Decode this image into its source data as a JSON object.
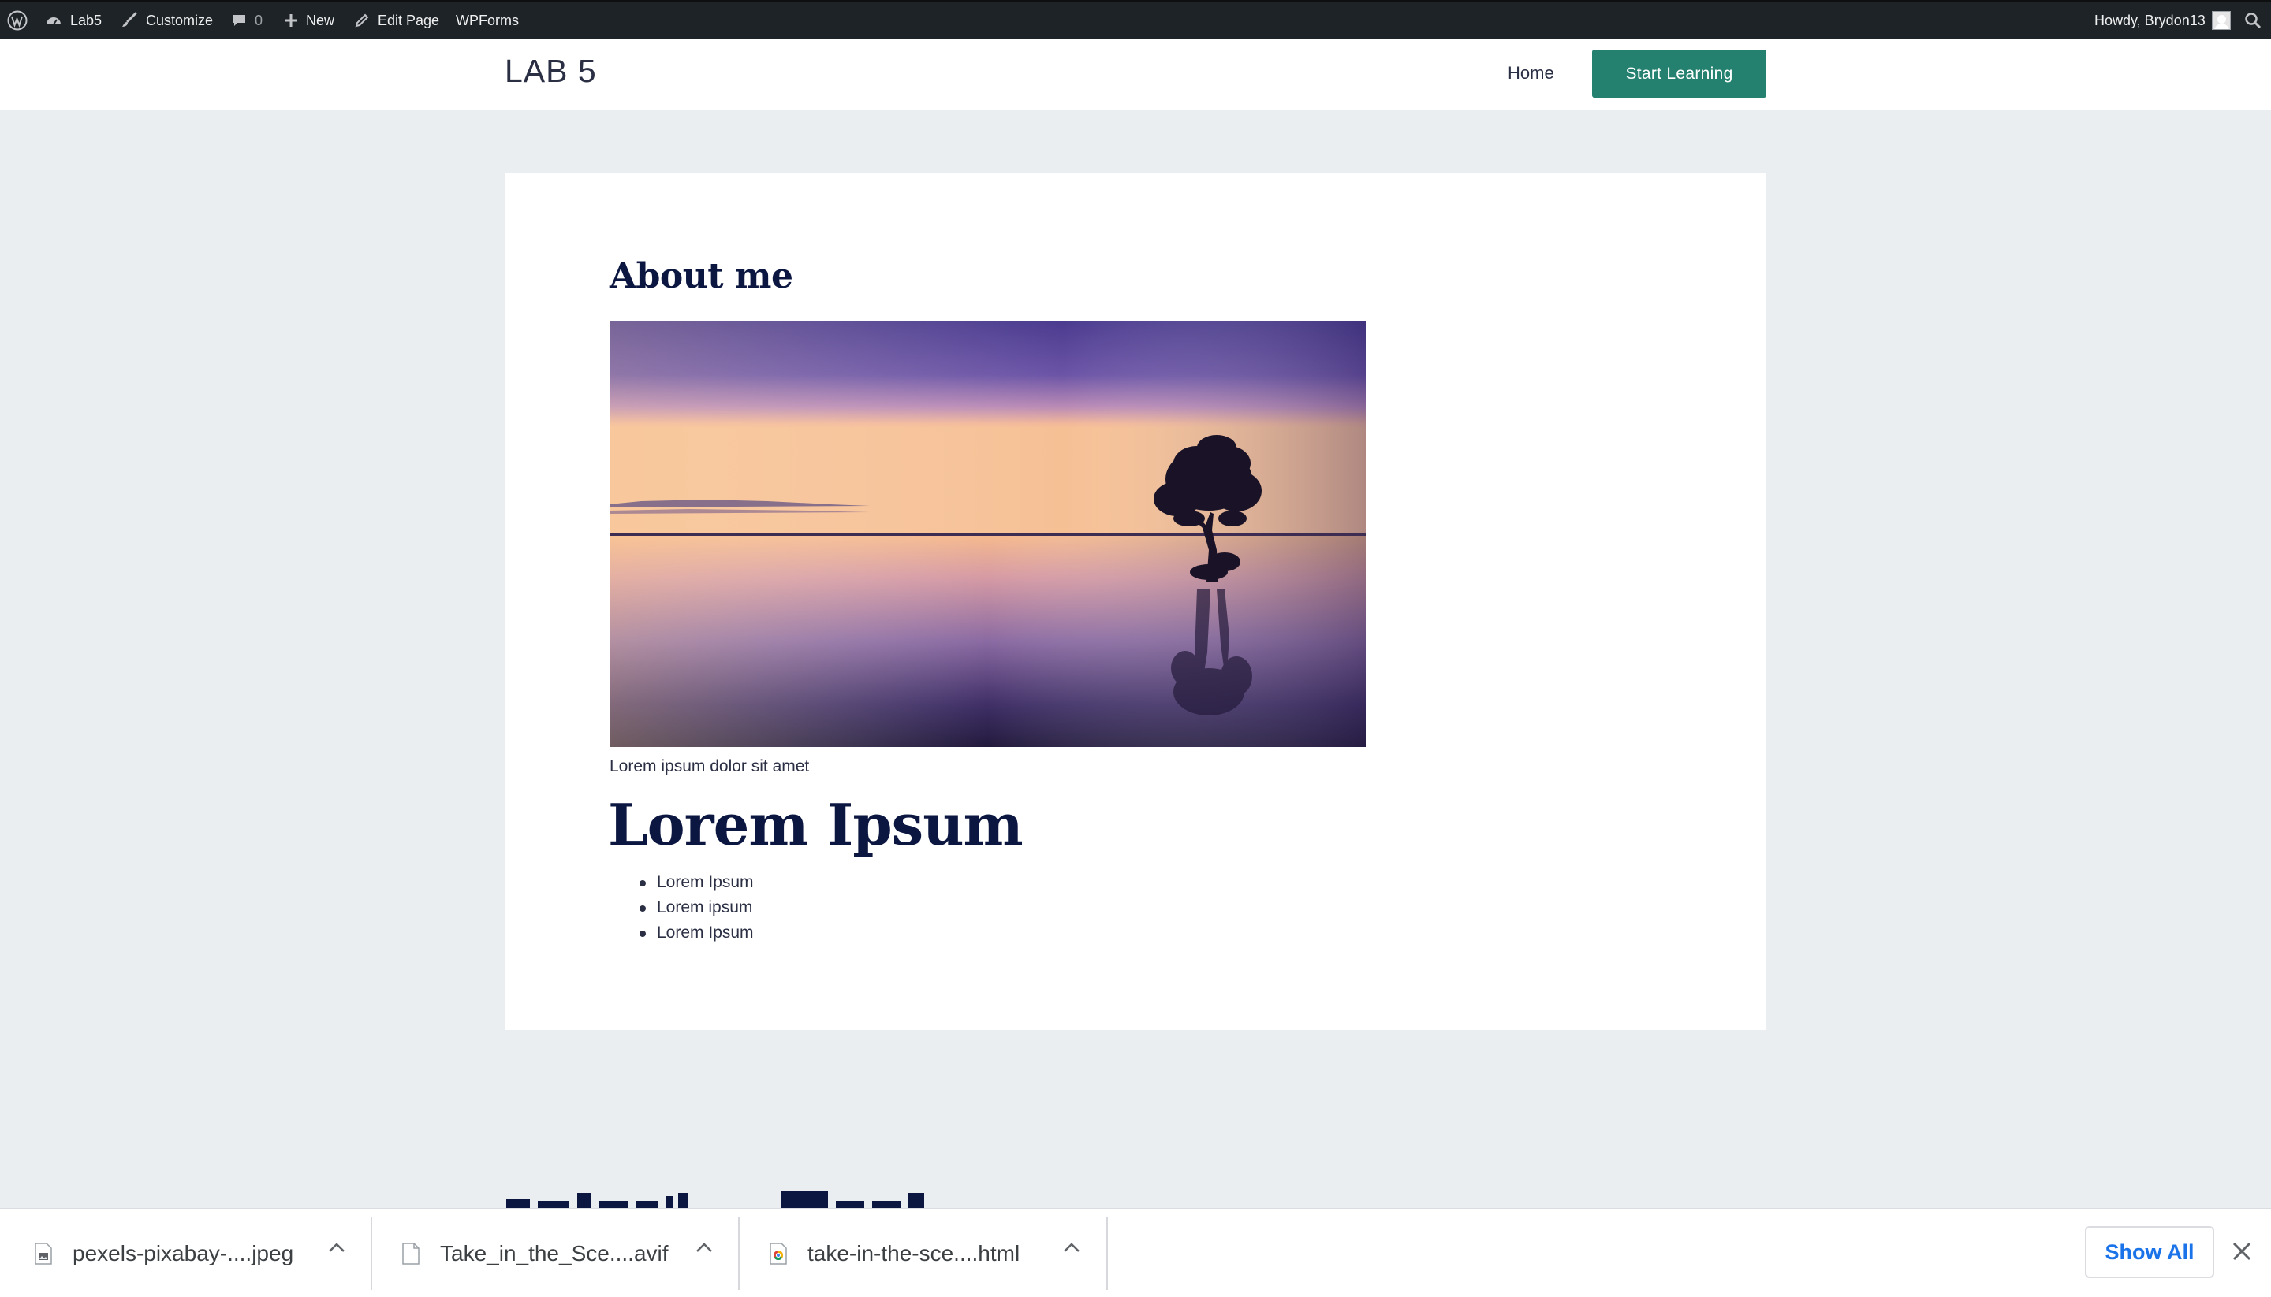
{
  "admin_bar": {
    "site_name": "Lab5",
    "customize": "Customize",
    "comments_count": "0",
    "new_label": "New",
    "edit_page": "Edit Page",
    "wpforms": "WPForms",
    "howdy": "Howdy, Brydon13"
  },
  "header": {
    "site_title": "LAB 5",
    "nav_home": "Home",
    "cta_label": "Start Learning"
  },
  "content": {
    "about_title": "About me",
    "image_caption": "Lorem ipsum dolor sit amet",
    "heading": "Lorem Ipsum",
    "list": [
      "Lorem Ipsum",
      "Lorem ipsum",
      "Lorem Ipsum"
    ]
  },
  "downloads": {
    "items": [
      {
        "name": "pexels-pixabay-....jpeg"
      },
      {
        "name": "Take_in_the_Sce....avif"
      },
      {
        "name": "take-in-the-sce....html"
      }
    ],
    "show_all": "Show All"
  },
  "colors": {
    "admin_bar_bg": "#1d2327",
    "page_bg": "#ebeef1",
    "heading_navy": "#0c1741",
    "cta_teal": "#24806f",
    "link_blue": "#1a73e8"
  }
}
